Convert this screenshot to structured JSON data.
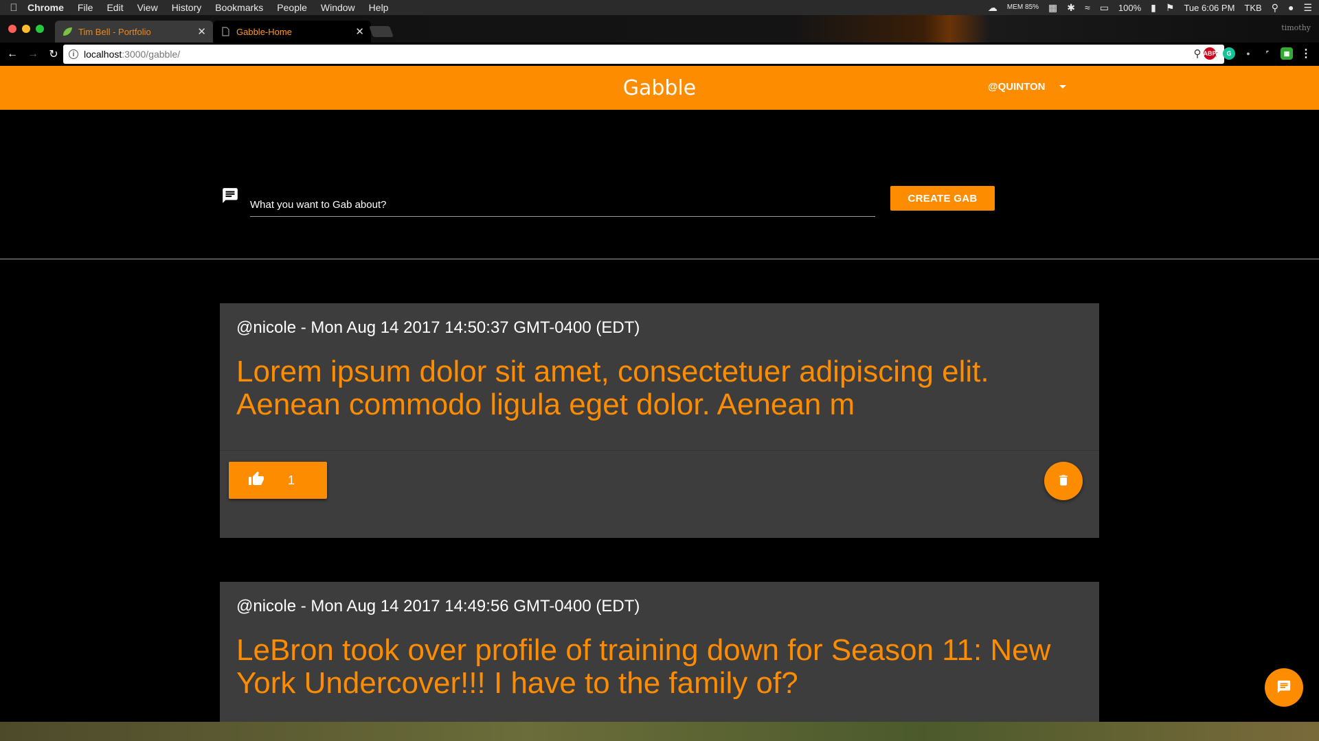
{
  "menubar": {
    "app": "Chrome",
    "items": [
      "File",
      "Edit",
      "View",
      "History",
      "Bookmarks",
      "People",
      "Window",
      "Help"
    ],
    "status": {
      "mem": "MEM 85%",
      "battery": "100%",
      "clock": "Tue 6:06 PM",
      "user": "TKB"
    }
  },
  "browser": {
    "tabs": [
      {
        "title": "Tim Bell - Portfolio",
        "active": false
      },
      {
        "title": "Gabble-Home",
        "active": true
      }
    ],
    "profile": "timothy",
    "url_host": "localhost",
    "url_path": ":3000/gabble/"
  },
  "header": {
    "brand": "Gabble",
    "user": "@QUINTON"
  },
  "compose": {
    "placeholder": "What you want to Gab about?",
    "button": "CREATE GAB"
  },
  "gabs": [
    {
      "meta": "@nicole - Mon Aug 14 2017 14:50:37 GMT-0400 (EDT)",
      "body": "Lorem ipsum dolor sit amet, consectetuer adipiscing elit. Aenean commodo ligula eget dolor. Aenean m",
      "likes": "1"
    },
    {
      "meta": "@nicole - Mon Aug 14 2017 14:49:56 GMT-0400 (EDT)",
      "body": "LeBron took over profile of training down for Season 11: New York Undercover!!! I have to the family of?"
    }
  ],
  "colors": {
    "accent": "#fd8c00",
    "card": "#3d3d3d",
    "background": "#000000"
  },
  "icons": {
    "compose": "message-icon",
    "like": "thumb-up-icon",
    "delete": "trash-icon",
    "fab": "chat-icon"
  }
}
